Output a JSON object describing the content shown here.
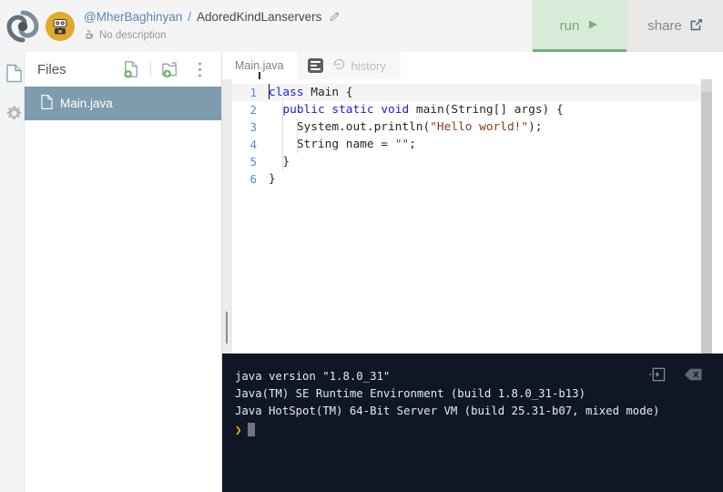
{
  "header": {
    "logo_icon": "codeanywhere-spiral-logo",
    "avatar_icon": "robot-avatar",
    "owner": "@MherBaghinyan",
    "separator": "/",
    "project_name": "AdoredKindLanservers",
    "edit_icon": "pencil-icon",
    "language_icon": "java-cup-icon",
    "description": "No description",
    "run_label": "run",
    "run_icon": "play-icon",
    "share_label": "share",
    "share_icon": "share-export-icon",
    "run_bg": "#d6ecd8",
    "run_accent": "#6fb377"
  },
  "rail": {
    "items": [
      {
        "icon": "file-page-icon",
        "name": "rail-files"
      },
      {
        "icon": "gear-icon",
        "name": "rail-settings"
      }
    ]
  },
  "sidebar": {
    "title": "Files",
    "actions": [
      {
        "icon": "new-file-icon",
        "label": "New File"
      },
      {
        "icon": "new-folder-icon",
        "label": "New Folder"
      },
      {
        "icon": "more-vertical-icon",
        "label": "More"
      }
    ],
    "files": [
      {
        "name": "Main.java",
        "icon": "file-icon",
        "selected": true
      }
    ],
    "selected_bg": "#7d9cad"
  },
  "editor": {
    "tabs": [
      {
        "label": "Main.java",
        "active": true
      }
    ],
    "doc_icon": "document-lines-icon",
    "history_icon": "history-revert-icon",
    "history_label": "history",
    "line_numbers": [
      "1",
      "2",
      "3",
      "4",
      "5",
      "6"
    ],
    "active_line": 1,
    "lines": [
      {
        "n": 1,
        "text": "class Main {"
      },
      {
        "n": 2,
        "text": "  public static void main(String[] args) {"
      },
      {
        "n": 3,
        "text": "    System.out.println(\"Hello world!\");"
      },
      {
        "n": 4,
        "text": "    String name = \"\";"
      },
      {
        "n": 5,
        "text": "  }"
      },
      {
        "n": 6,
        "text": "}"
      }
    ],
    "colors": {
      "keyword": "#1d1ddd",
      "string": "#8b3a1e",
      "linenum": "#5b8ccc",
      "text": "#262626"
    }
  },
  "console": {
    "lines": [
      "java version \"1.8.0_31\"",
      "Java(TM) SE Runtime Environment (build 1.8.0_31-b13)",
      "Java HotSpot(TM) 64-Bit Server VM (build 25.31-b07, mixed mode)"
    ],
    "prompt_symbol": "❯",
    "tools": [
      {
        "icon": "open-in-window-icon",
        "label": "Detach Console"
      },
      {
        "icon": "clear-console-icon",
        "label": "Clear Console"
      }
    ],
    "bg": "#101626"
  }
}
